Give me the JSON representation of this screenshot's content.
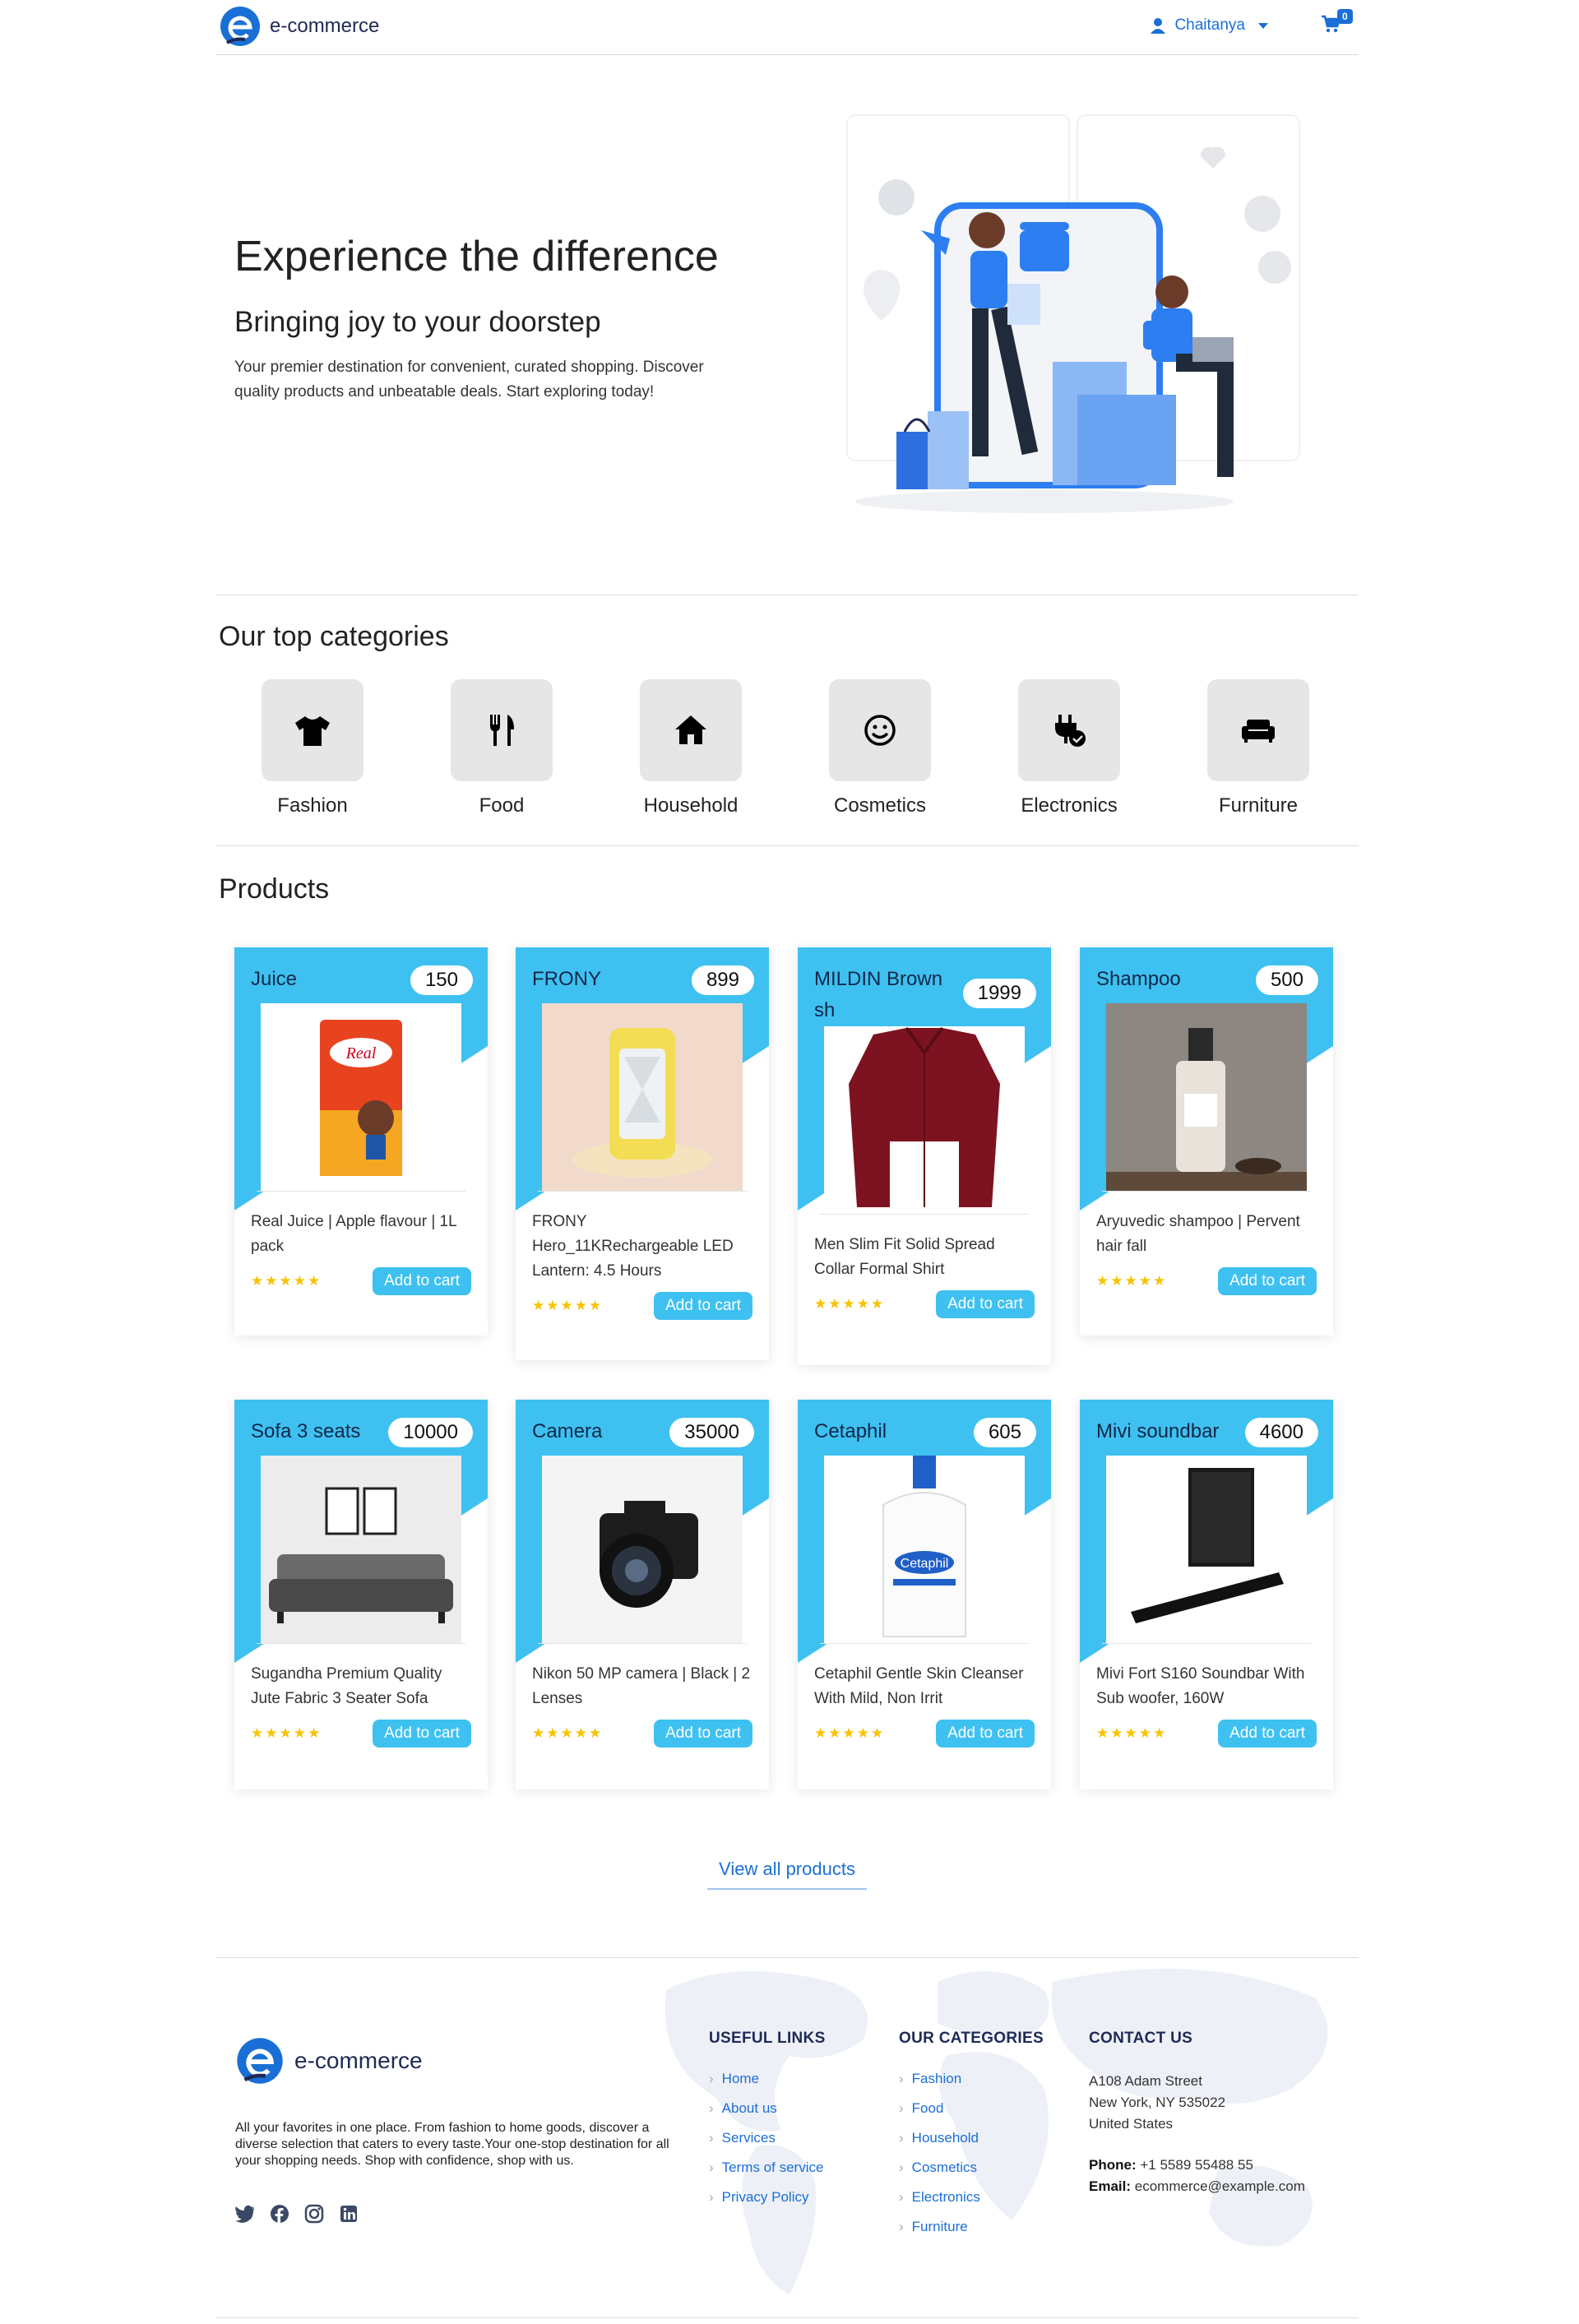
{
  "nav": {
    "brand": "e-commerce",
    "user_name": "Chaitanya",
    "cart_count": "0"
  },
  "hero": {
    "title": "Experience the difference",
    "subtitle": "Bringing joy to your doorstep",
    "description": "Your premier destination for convenient, curated shopping. Discover quality products and unbeatable deals. Start exploring today!"
  },
  "categories": {
    "title": "Our top categories",
    "items": [
      {
        "label": "Fashion",
        "icon": "tshirt-icon"
      },
      {
        "label": "Food",
        "icon": "utensils-icon"
      },
      {
        "label": "Household",
        "icon": "house-icon"
      },
      {
        "label": "Cosmetics",
        "icon": "smile-icon"
      },
      {
        "label": "Electronics",
        "icon": "plug-icon"
      },
      {
        "label": "Furniture",
        "icon": "couch-icon"
      }
    ]
  },
  "products": {
    "title": "Products",
    "add_label": "Add to cart",
    "stars": "★★★★★",
    "items": [
      {
        "name": "Juice",
        "price": "150",
        "desc": "Real Juice | Apple flavour | 1L pack"
      },
      {
        "name": "FRONY",
        "price": "899",
        "desc": "FRONY Hero_11KRechargeable LED Lantern: 4.5 Hours"
      },
      {
        "name": "MILDIN Brown sh",
        "price": "1999",
        "desc": "Men Slim Fit Solid Spread Collar Formal Shirt"
      },
      {
        "name": "Shampoo",
        "price": "500",
        "desc": "Aryuvedic shampoo | Pervent hair fall"
      },
      {
        "name": "Sofa 3 seats",
        "price": "10000",
        "desc": "Sugandha Premium Quality Jute Fabric 3 Seater Sofa"
      },
      {
        "name": "Camera",
        "price": "35000",
        "desc": "Nikon 50 MP camera | Black | 2 Lenses"
      },
      {
        "name": "Cetaphil",
        "price": "605",
        "desc": "Cetaphil Gentle Skin Cleanser With Mild, Non Irrit"
      },
      {
        "name": "Mivi soundbar",
        "price": "4600",
        "desc": "Mivi Fort S160 Soundbar With Sub woofer, 160W"
      }
    ],
    "view_all": "View all products"
  },
  "footer": {
    "brand": "e-commerce",
    "description": "All your favorites in one place. From fashion to home goods, discover a diverse selection that caters to every taste.Your one-stop destination for all your shopping needs. Shop with confidence, shop with us.",
    "useful_links": {
      "title": "USEFUL LINKS",
      "items": [
        "Home",
        "About us",
        "Services",
        "Terms of service",
        "Privacy Policy"
      ]
    },
    "our_categories": {
      "title": "OUR CATEGORIES",
      "items": [
        "Fashion",
        "Food",
        "Household",
        "Cosmetics",
        "Electronics",
        "Furniture"
      ]
    },
    "contact": {
      "title": "CONTACT US",
      "street": "A108 Adam Street",
      "city": "New York, NY 535022",
      "country": "United States",
      "phone_label": "Phone:",
      "phone": "+1 5589 55488 55",
      "email_label": "Email:",
      "email": "ecommerce@example.com"
    },
    "social_icons": [
      "twitter-icon",
      "facebook-icon",
      "instagram-icon",
      "linkedin-icon"
    ]
  },
  "colors": {
    "accent": "#3ec1f0",
    "link": "#1a6fd6",
    "brand_dark": "#1e2a55",
    "star": "#f7c300"
  }
}
